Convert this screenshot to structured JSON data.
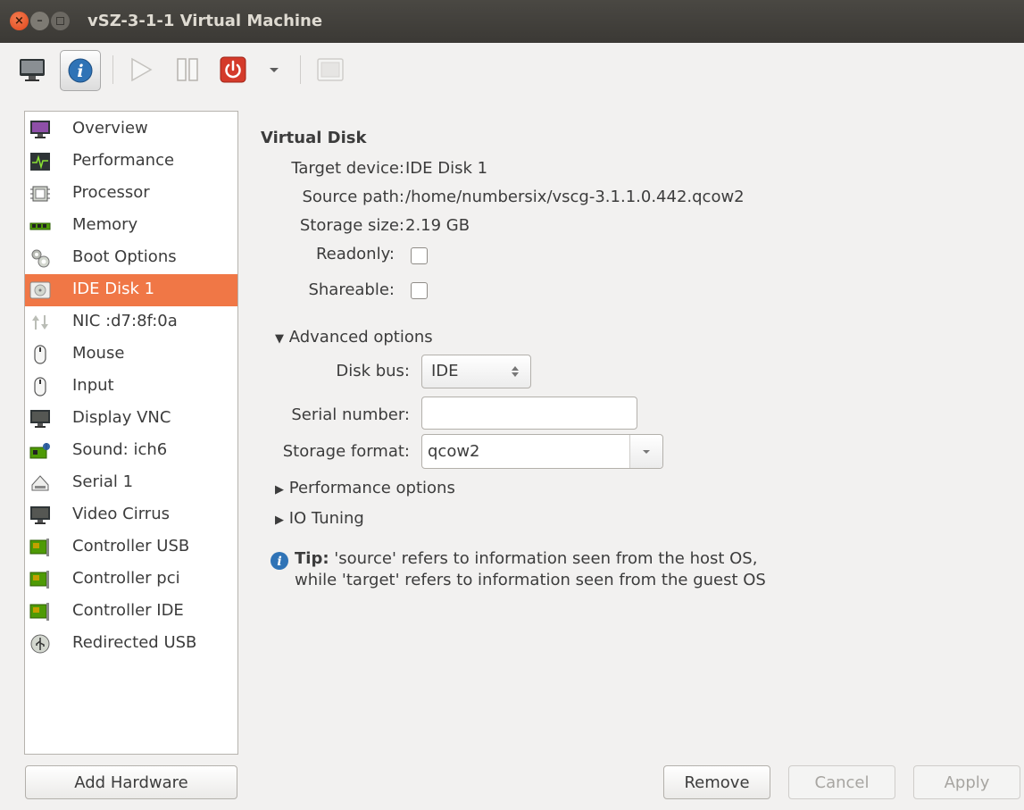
{
  "window": {
    "title": "vSZ-3-1-1 Virtual Machine"
  },
  "sidebar": {
    "items": [
      {
        "label": "Overview",
        "icon": "monitor-purple-icon"
      },
      {
        "label": "Performance",
        "icon": "performance-graph-icon"
      },
      {
        "label": "Processor",
        "icon": "processor-chip-icon"
      },
      {
        "label": "Memory",
        "icon": "memory-module-icon"
      },
      {
        "label": "Boot Options",
        "icon": "gears-icon"
      },
      {
        "label": "IDE Disk 1",
        "icon": "hard-disk-icon"
      },
      {
        "label": "NIC :d7:8f:0a",
        "icon": "network-arrows-icon"
      },
      {
        "label": "Mouse",
        "icon": "mouse-icon"
      },
      {
        "label": "Input",
        "icon": "mouse-icon"
      },
      {
        "label": "Display VNC",
        "icon": "display-icon"
      },
      {
        "label": "Sound: ich6",
        "icon": "sound-card-icon"
      },
      {
        "label": "Serial 1",
        "icon": "serial-port-icon"
      },
      {
        "label": "Video Cirrus",
        "icon": "display-icon"
      },
      {
        "label": "Controller USB",
        "icon": "controller-card-icon"
      },
      {
        "label": "Controller pci",
        "icon": "controller-card-icon"
      },
      {
        "label": "Controller IDE",
        "icon": "controller-card-icon"
      },
      {
        "label": "Redirected USB",
        "icon": "usb-icon"
      }
    ],
    "selected": "IDE Disk 1",
    "add_hardware_label": "Add Hardware"
  },
  "disk": {
    "section_title": "Virtual Disk",
    "target_device_label": "Target device:",
    "target_device_value": "IDE Disk 1",
    "source_path_label": "Source path:",
    "source_path_value": "/home/numbersix/vscg-3.1.1.0.442.qcow2",
    "storage_size_label": "Storage size:",
    "storage_size_value": "2.19 GB",
    "readonly_label": "Readonly:",
    "readonly_checked": false,
    "shareable_label": "Shareable:",
    "shareable_checked": false
  },
  "advanced": {
    "expander_label": "Advanced options",
    "disk_bus_label": "Disk bus:",
    "disk_bus_value": "IDE",
    "serial_number_label": "Serial number:",
    "serial_number_value": "",
    "storage_format_label": "Storage format:",
    "storage_format_value": "qcow2",
    "performance_label": "Performance options",
    "io_tuning_label": "IO Tuning"
  },
  "tip": {
    "bold": "Tip:",
    "line1": " 'source' refers to information seen from the host OS,",
    "line2": "while 'target' refers to information seen from the guest OS"
  },
  "buttons": {
    "remove": "Remove",
    "cancel": "Cancel",
    "apply": "Apply"
  },
  "colors": {
    "selection": "#f07746",
    "titlebar": "#3c3b37",
    "power": "#d43a2a"
  }
}
